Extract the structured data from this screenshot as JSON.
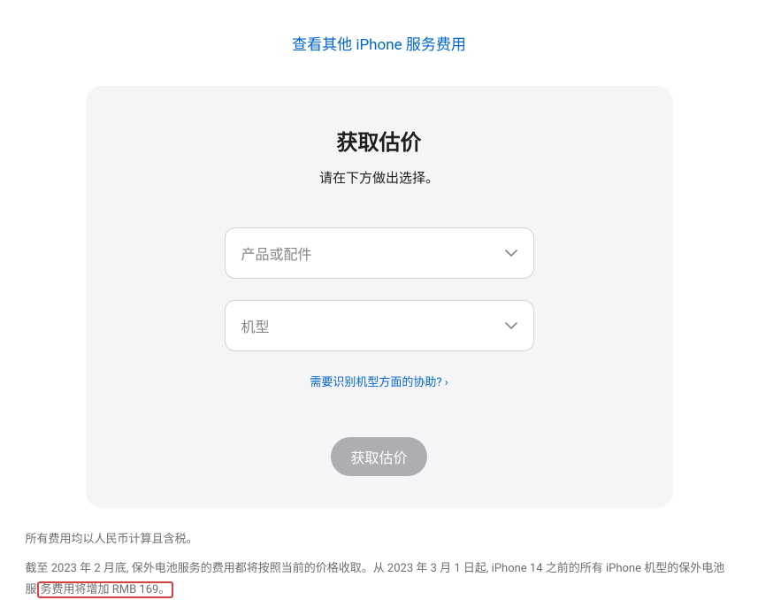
{
  "topLink": {
    "label": "查看其他 iPhone 服务费用"
  },
  "card": {
    "title": "获取估价",
    "subtitle": "请在下方做出选择。",
    "selectProduct": {
      "placeholder": "产品或配件"
    },
    "selectModel": {
      "placeholder": "机型"
    },
    "helpLink": {
      "label": "需要识别机型方面的协助?"
    },
    "submit": {
      "label": "获取估价"
    }
  },
  "footnotes": {
    "line1": "所有费用均以人民币计算且含税。",
    "line2a": "截至 2023 年 2 月底, 保外电池服务的费用都将按照当前的价格收取。从 2023 年 3 月 1 日起, iPhone 14 之前的所有 iPhone 机型的保外电池服",
    "line2b": "务费用将增加 RMB 169。"
  }
}
